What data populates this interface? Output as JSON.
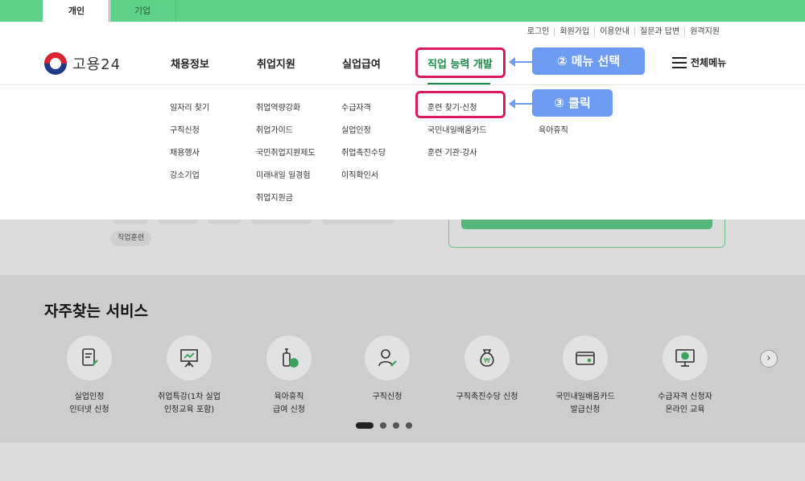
{
  "top_tabs": [
    "개인",
    "기업"
  ],
  "utility_links": [
    "로그인",
    "회원가입",
    "이용안내",
    "질문과 답변",
    "원격지원"
  ],
  "logo_text": "고용24",
  "gnb": [
    "채용정보",
    "취업지원",
    "실업급여",
    "직업 능력 개발"
  ],
  "all_menu_label": "전체메뉴",
  "submenu": {
    "col1": [
      "일자리 찾기",
      "구직신청",
      "채용행사",
      "강소기업"
    ],
    "col2": [
      "취업역량강화",
      "취업가이드",
      "국민취업지원제도",
      "미래내일 일경험",
      "취업지원금"
    ],
    "col3": [
      "수급자격",
      "실업인정",
      "취업촉진수당",
      "이직확인서"
    ],
    "col4": [
      "훈련 찾기·신청",
      "국민내일배움카드",
      "훈련 기관·강사"
    ],
    "col5": [
      "육아휴직"
    ]
  },
  "annotations": {
    "step2": "② 메뉴 선택",
    "step3": "③ 클릭"
  },
  "behind_tag": "직업훈련",
  "services": {
    "title": "자주찾는 서비스",
    "items": [
      {
        "label": "실업인정\n인터넷 신청",
        "icon": "document-pen-icon"
      },
      {
        "label": "취업특강(1차 실업\n인정교육 포함)",
        "icon": "presentation-board-icon"
      },
      {
        "label": "육아휴직\n급여 신청",
        "icon": "baby-bottle-won-icon"
      },
      {
        "label": "구직신청",
        "icon": "person-pen-icon"
      },
      {
        "label": "구직촉진수당 신청",
        "icon": "money-bag-won-icon"
      },
      {
        "label": "국민내일배움카드\n발급신청",
        "icon": "card-icon"
      },
      {
        "label": "수급자격 신청자\n온라인 교육",
        "icon": "monitor-play-icon"
      }
    ],
    "next_arrow": "›"
  },
  "colors": {
    "brand_green": "#5ed18a",
    "active_green": "#1b8a4a",
    "highlight": "#d81b60",
    "callout_blue": "#6d9bf1"
  }
}
